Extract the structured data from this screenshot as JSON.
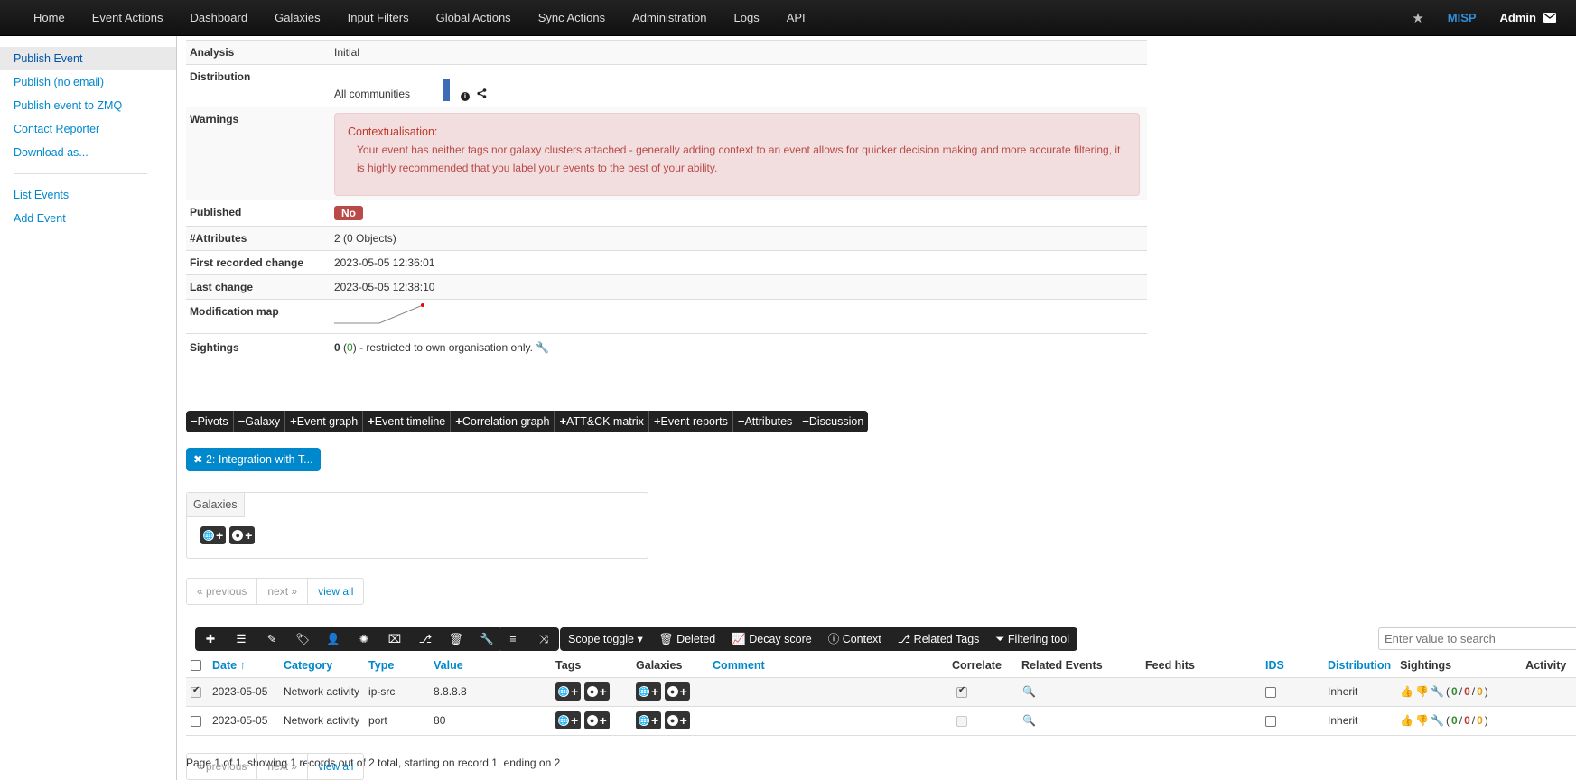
{
  "topnav": {
    "items": [
      "Home",
      "Event Actions",
      "Dashboard",
      "Galaxies",
      "Input Filters",
      "Global Actions",
      "Sync Actions",
      "Administration",
      "Logs",
      "API"
    ],
    "brand": "MISP",
    "user": "Admin"
  },
  "sidebar": {
    "items": [
      "Publish Event",
      "Publish (no email)",
      "Publish event to ZMQ",
      "Contact Reporter",
      "Download as..."
    ],
    "items2": [
      "List Events",
      "Add Event"
    ]
  },
  "details": {
    "analysis_key": "Analysis",
    "analysis_val": "Initial",
    "distribution_key": "Distribution",
    "distribution_val": "All communities",
    "warnings_key": "Warnings",
    "warning_title": "Contextualisation:",
    "warning_body": "Your event has neither tags nor galaxy clusters attached - generally adding context to an event allows for quicker decision making and more accurate filtering, it is highly recommended that you label your events to the best of your ability.",
    "published_key": "Published",
    "published_val": "No",
    "attributes_key": "#Attributes",
    "attributes_val": "2 (0 Objects)",
    "first_change_key": "First recorded change",
    "first_change_val": "2023-05-05 12:36:01",
    "last_change_key": "Last change",
    "last_change_val": "2023-05-05 12:38:10",
    "modmap_key": "Modification map",
    "sightings_key": "Sightings",
    "sightings_count": "0",
    "sightings_inner": "0",
    "sightings_note": "- restricted to own organisation only."
  },
  "toggles": [
    "Pivots",
    "Galaxy",
    "Event graph",
    "Event timeline",
    "Correlation graph",
    "ATT&CK matrix",
    "Event reports",
    "Attributes",
    "Discussion"
  ],
  "toggle_signs": [
    "−",
    "−",
    "+",
    "+",
    "+",
    "+",
    "+",
    "−",
    "−"
  ],
  "object_pill": "2: Integration with T...",
  "galaxies_tab": "Galaxies",
  "pager": {
    "prev": "« previous",
    "next": "next »",
    "all": "view all"
  },
  "toolbar": {
    "scope": "Scope toggle",
    "deleted": "Deleted",
    "decay": "Decay score",
    "context": "Context",
    "related_tags": "Related Tags",
    "filtering": "Filtering tool"
  },
  "search": {
    "placeholder": "Enter value to search"
  },
  "table": {
    "headers": [
      "Date",
      "Category",
      "Type",
      "Value",
      "Tags",
      "Galaxies",
      "Comment",
      "Correlate",
      "Related Events",
      "Feed hits",
      "IDS",
      "Distribution",
      "Sightings",
      "Activity"
    ],
    "rows": [
      {
        "date": "2023-05-05",
        "category": "Network activity",
        "type": "ip-src",
        "value": "8.8.8.8",
        "distribution": "Inherit",
        "s1": "0",
        "s2": "0",
        "s3": "0"
      },
      {
        "date": "2023-05-05",
        "category": "Network activity",
        "type": "port",
        "value": "80",
        "distribution": "Inherit",
        "s1": "0",
        "s2": "0",
        "s3": "0"
      }
    ]
  },
  "page_info": "Page 1 of 1, showing 1 records out of 2 total, starting on record 1, ending on 2"
}
